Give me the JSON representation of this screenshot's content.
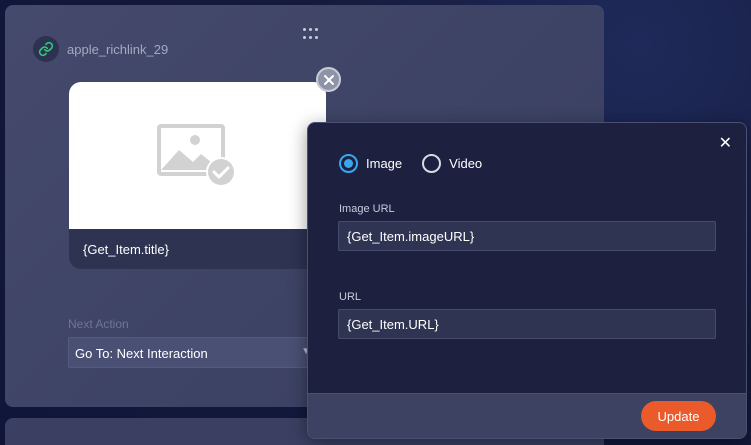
{
  "node": {
    "title": "apple_richlink_29",
    "card_title": "{Get_Item.title}",
    "next_action_label": "Next Action",
    "next_action_value": "Go To: Next Interaction"
  },
  "panel": {
    "media_options": [
      {
        "label": "Image",
        "checked": true
      },
      {
        "label": "Video",
        "checked": false
      }
    ],
    "image_url_label": "Image URL",
    "image_url_value": "{Get_Item.imageURL}",
    "url_label": "URL",
    "url_value": "{Get_Item.URL}",
    "update_label": "Update",
    "close_glyph": "✕"
  },
  "colors": {
    "accent": "#3aa6ee",
    "primary_button": "#ea5a2a",
    "link_icon": "#34c77b"
  },
  "icons": [
    "drag-handle-icon",
    "link-icon",
    "image-placeholder-icon",
    "check-icon",
    "remove-icon",
    "chevron-down-icon",
    "close-icon"
  ]
}
